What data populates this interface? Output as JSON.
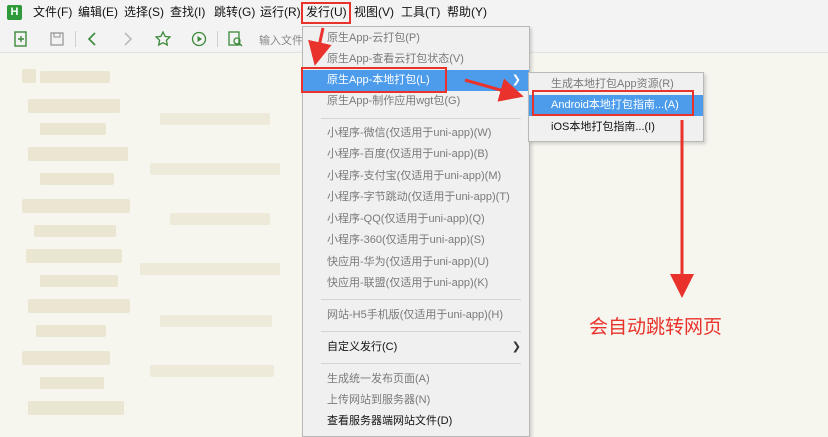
{
  "menubar": {
    "logo_text": "H",
    "items": [
      "文件(F)",
      "编辑(E)",
      "选择(S)",
      "查找(I)",
      "跳转(G)",
      "运行(R)",
      "发行(U)",
      "视图(V)",
      "工具(T)",
      "帮助(Y)"
    ]
  },
  "toolbar": {
    "search_placeholder": "输入文件"
  },
  "dropdown": {
    "items": [
      {
        "label": "原生App-云打包(P)"
      },
      {
        "label": "原生App-查看云打包状态(V)"
      },
      {
        "label": "原生App-本地打包(L)"
      },
      {
        "label": "原生App-制作应用wgt包(G)"
      },
      {
        "label": "小程序-微信(仅适用于uni-app)(W)"
      },
      {
        "label": "小程序-百度(仅适用于uni-app)(B)"
      },
      {
        "label": "小程序-支付宝(仅适用于uni-app)(M)"
      },
      {
        "label": "小程序-字节跳动(仅适用于uni-app)(T)"
      },
      {
        "label": "小程序-QQ(仅适用于uni-app)(Q)"
      },
      {
        "label": "小程序-360(仅适用于uni-app)(S)"
      },
      {
        "label": "快应用-华为(仅适用于uni-app)(U)"
      },
      {
        "label": "快应用-联盟(仅适用于uni-app)(K)"
      },
      {
        "label": "网站-H5手机版(仅适用于uni-app)(H)"
      },
      {
        "label": "自定义发行(C)"
      },
      {
        "label": "生成统一发布页面(A)"
      },
      {
        "label": "上传网站到服务器(N)"
      },
      {
        "label": "查看服务器端网站文件(D)"
      }
    ]
  },
  "submenu": {
    "items": [
      {
        "label": "生成本地打包App资源(R)"
      },
      {
        "label": "Android本地打包指南...(A)"
      },
      {
        "label": "iOS本地打包指南...(I)"
      }
    ]
  },
  "annotation": {
    "text": "会自动跳转网页",
    "color": "#e8322b"
  },
  "colors": {
    "highlight": "#4d9cec",
    "annotation_red": "#e8322b",
    "logo_green": "#2f9a3a"
  }
}
